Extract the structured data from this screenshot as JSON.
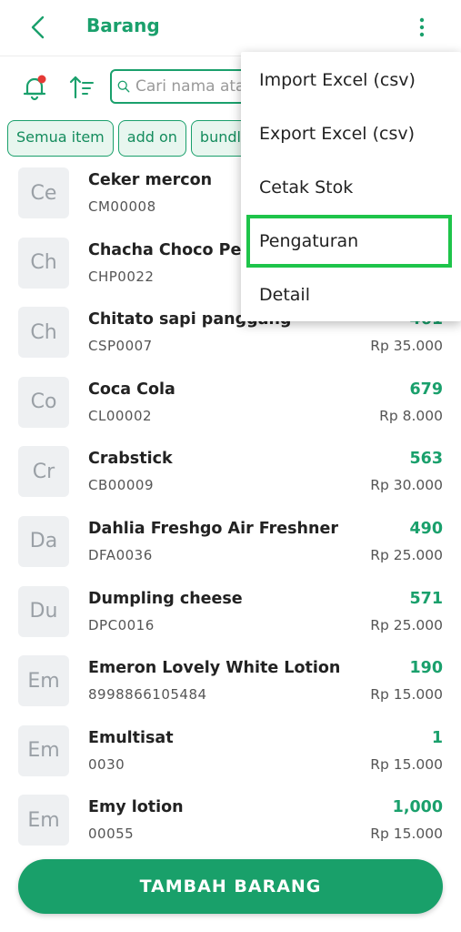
{
  "appbar": {
    "title": "Barang"
  },
  "search": {
    "placeholder": "Cari nama atau kode"
  },
  "chips": [
    "Semua item",
    "add on",
    "bundling"
  ],
  "items": [
    {
      "initials": "Ce",
      "name": "Ceker mercon",
      "code": "CM00008",
      "stock": "",
      "price": ""
    },
    {
      "initials": "Ch",
      "name": "Chacha Choco Peanut",
      "code": "CHP0022",
      "stock": "",
      "price": ""
    },
    {
      "initials": "Ch",
      "name": "Chitato sapi panggang",
      "code": "CSP0007",
      "stock": "461",
      "price": "Rp 35.000"
    },
    {
      "initials": "Co",
      "name": "Coca Cola",
      "code": "CL00002",
      "stock": "679",
      "price": "Rp 8.000"
    },
    {
      "initials": "Cr",
      "name": "Crabstick",
      "code": "CB00009",
      "stock": "563",
      "price": "Rp 30.000"
    },
    {
      "initials": "Da",
      "name": "Dahlia Freshgo Air Freshner",
      "code": "DFA0036",
      "stock": "490",
      "price": "Rp 25.000"
    },
    {
      "initials": "Du",
      "name": "Dumpling cheese",
      "code": "DPC0016",
      "stock": "571",
      "price": "Rp 25.000"
    },
    {
      "initials": "Em",
      "name": "Emeron Lovely White Lotion",
      "code": "8998866105484",
      "stock": "190",
      "price": "Rp 15.000"
    },
    {
      "initials": "Em",
      "name": "Emultisat",
      "code": "0030",
      "stock": "1",
      "price": "Rp 15.000"
    },
    {
      "initials": "Em",
      "name": "Emy lotion",
      "code": "00055",
      "stock": "1,000",
      "price": "Rp 15.000"
    }
  ],
  "cta": {
    "label": "TAMBAH BARANG"
  },
  "menu": {
    "items": [
      "Import Excel (csv)",
      "Export Excel (csv)",
      "Cetak Stok",
      "Pengaturan",
      "Detail"
    ],
    "highlighted_index": 3
  },
  "colors": {
    "primary": "#1aa06c",
    "highlight": "#1ec44a",
    "notification": "#e53935"
  }
}
